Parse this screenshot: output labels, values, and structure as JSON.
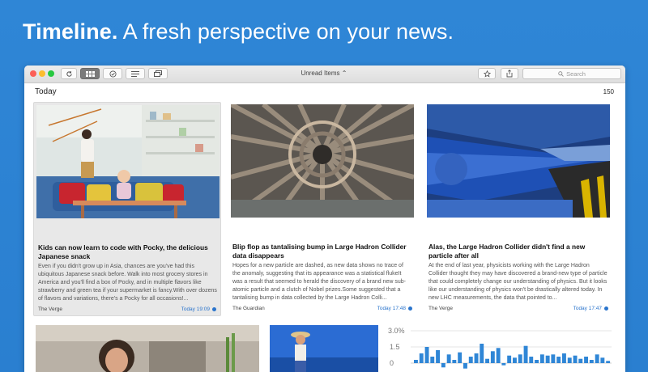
{
  "headline": {
    "bold": "Timeline.",
    "rest": " A fresh perspective on your news."
  },
  "toolbar": {
    "title": "Unread Items ⌃",
    "search_placeholder": "Search"
  },
  "section": {
    "label": "Today",
    "count": "150"
  },
  "cards": [
    {
      "title": "Kids can now learn to code with Pocky, the delicious Japanese snack",
      "excerpt": "Even if you didn't grow up in Asia, chances are you've had this ubiquitous Japanese snack before. Walk into most grocery stores in America and you'll find a box of Pocky, and in multiple flavors like strawberry and green tea if your supermarket is fancy.With over dozens of flavors and variations, there's a Pocky for all occasions!...",
      "source": "The Verge",
      "time": "Today 19:09"
    },
    {
      "title": "Blip flop as tantalising bump in Large Hadron Collider data disappears",
      "excerpt": "Hopes for a new particle are dashed, as new data shows no trace of the anomaly, suggesting that its appearance was a statistical flukeIt was a result that seemed to herald the discovery of a brand new sub-atomic particle and a clutch of Nobel prizes.Some suggested that a tantalising bump in data collected by the Large Hadron Colli...",
      "source": "The Guardian",
      "time": "Today 17:48"
    },
    {
      "title": "Alas, the Large Hadron Collider didn't find a new particle after all",
      "excerpt": "At the end of last year, physicists working with the Large Hadron Collider thought they may have discovered a brand-new type of particle that could completely change our understanding of physics. But it looks like our understanding of physics won't be drastically altered today. In new LHC measurements, the data that pointed to...",
      "source": "The Verge",
      "time": "Today 17:47"
    }
  ],
  "chart_data": {
    "type": "bar",
    "y_ticks": [
      "3.0%",
      "1.5",
      "0"
    ],
    "values": [
      0.3,
      0.9,
      1.5,
      0.6,
      1.2,
      -0.4,
      0.8,
      0.3,
      1.0,
      -0.5,
      0.6,
      0.9,
      1.8,
      0.4,
      1.1,
      1.4,
      -0.2,
      0.7,
      0.5,
      0.8,
      1.6,
      0.6,
      0.3,
      0.8,
      0.7,
      0.8,
      0.6,
      0.9,
      0.5,
      0.7,
      0.4,
      0.6,
      0.3,
      0.8,
      0.5,
      0.2
    ],
    "ylim": [
      -0.6,
      3.0
    ]
  },
  "colors": {
    "background": "#2a7fd0",
    "accent": "#2a74cc"
  }
}
